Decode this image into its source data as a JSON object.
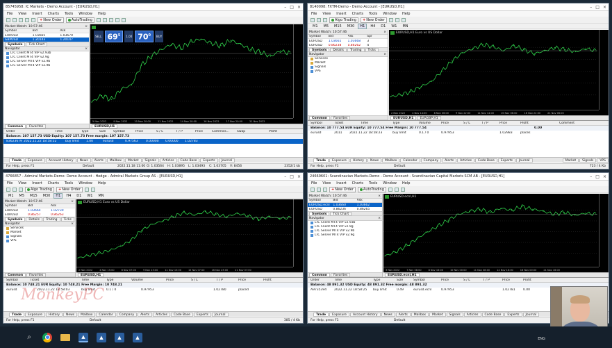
{
  "menus": [
    "File",
    "View",
    "Insert",
    "Charts",
    "Tools",
    "Window",
    "Help"
  ],
  "windows": {
    "tl": {
      "title": "85745958: IC Markets - Demo Account - [EURUSD,H1]",
      "toolbar": {
        "new_order": "New Order",
        "auto_trading": "AutoTrading"
      },
      "mw_header": "Market Watch: 10:57:46",
      "mw_cols": [
        "Symbol",
        "Bid",
        "Ask"
      ],
      "mw_rows": [
        [
          "EURUSD",
          "1.03665",
          "1.03670"
        ],
        [
          "GBPUSD",
          "1.20143",
          "1.20147"
        ]
      ],
      "mw_tabs": [
        "Symbols",
        "Tick Chart"
      ],
      "nav_header": "Navigator",
      "nav": [
        "LTC Client MT4 VIP v2.93b",
        "LTC Client MT4 VIP v2.9g",
        "LTC Server MT4 VIP v2.9b",
        "LTC Server MT4 VIP v2.9b"
      ],
      "nav_tabs": [
        "Common",
        "Favorites"
      ],
      "chart_label": "EURUSD,H1",
      "oc_sell": "SELL",
      "oc_buy": "BUY",
      "oc_lot": "1.00",
      "oc_bid": "69",
      "oc_bid_sup": "5",
      "oc_ask": "70",
      "oc_ask_sup": "0",
      "times": [
        "5 Nov 2022",
        "9 Nov 2022",
        "10 Nov 20:00",
        "11 Nov 2022",
        "14 Nov 20:00",
        "16 Nov 2022",
        "17 Nov 20:00",
        "21 Nov 2022"
      ],
      "chart_tab": "EURUSD,H1",
      "term_cols": [
        "Order",
        "Time",
        "Type",
        "Size",
        "Symbol",
        "Price",
        "S / L",
        "T / P",
        "Price",
        "Commiss...",
        "Swap",
        "Profit"
      ],
      "balance": "Balance: 107 157.73 USD  Equity: 107 157.73  Free margin: 107 157.73",
      "order_row": [
        "83623679",
        "2022.11.22 18:58:52",
        "buy limit",
        "1.00",
        "eurusd",
        "0.97563",
        "0.00000",
        "0.00000",
        "1.02783"
      ],
      "term_tabs": [
        "Trade",
        "Exposure",
        "Account History",
        "News",
        "Alerts",
        "Mailbox",
        "Market",
        "Signals",
        "Articles",
        "Code Base",
        "Experts",
        "Journal"
      ],
      "status": [
        "For Help, press F1",
        "Default",
        "2022.11.18 11:00",
        "O: 1.03564",
        "H: 1.03895",
        "L: 1.03493",
        "C: 1.03705",
        "V: 8456",
        "2352/1 kb"
      ]
    },
    "tr": {
      "title": "8140098: FXTM-Demo - Demo Account - [EURUSD,H1]",
      "toolbar": {
        "new_order": "New Order",
        "auto_trading": "Algo Trading"
      },
      "tfs": [
        "M1",
        "M5",
        "M15",
        "M30",
        "H1",
        "H4",
        "D1",
        "W1",
        "MN"
      ],
      "mw_header": "Market Watch: 10:57:46",
      "mw_cols": [
        "Symbol",
        "Bid",
        "Ask",
        "Spr"
      ],
      "mw_rows": [
        [
          "EURUSD",
          "1.03665",
          "1.03668",
          "3"
        ],
        [
          "EURUSD",
          "0.86238",
          "0.86262",
          "4"
        ]
      ],
      "mw_tabs": [
        "Symbols",
        "Details",
        "Trading",
        "Ticks"
      ],
      "nav_header": "Navigator",
      "nav": [
        "Services",
        "Market",
        "Signals",
        "VPS"
      ],
      "nav_tabs": [
        "Common",
        "Favorites"
      ],
      "chart_label": "EURUSD,H1  Euro vs US Dollar",
      "times": [
        "2 Nov 2022",
        "4 Nov 14:00",
        "8 Nov 06:00",
        "9 Nov 22:00",
        "11 Nov 14:00",
        "15 Nov 06:00",
        "16 Nov 22:00",
        "21 Nov 06:00"
      ],
      "chart_tabs": [
        "EURUSD,H1",
        "EURGBP,H1"
      ],
      "term_cols": [
        "Symbol",
        "Ticket",
        "Time",
        "Type",
        "Volume",
        "Price",
        "S / L",
        "T / P",
        "Price",
        "Profit",
        "Comment"
      ],
      "balance": "Balance: 10 777.54 EUR  Equity: 10 777.54  Free Margin: 10 777.54",
      "balance_profit": "0.00",
      "order_row": [
        "eurusd",
        "2011",
        "2022.11.22 18:58:23",
        "buy limit",
        "0.1 / 0",
        "0.97953",
        "",
        "",
        "1.02983",
        "places"
      ],
      "term_tabs": [
        "Trade",
        "Exposure",
        "History",
        "News",
        "Mailbox",
        "Calendar",
        "Company",
        "Alerts",
        "Articles",
        "Code Base",
        "Experts",
        "Journal"
      ],
      "term_right": [
        "Market",
        "Signals",
        "VPS"
      ],
      "status": [
        "For Help, press F1",
        "Default",
        "723 / 4 Kb"
      ]
    },
    "bl": {
      "title": "4766857 - Admiral Markets-Demo: Demo Account - Hedge - Admiral Markets Group AS - [EURUSD,H1]",
      "toolbar": {
        "new_order": "New Order",
        "auto_trading": "Algo Trading"
      },
      "tfs": [
        "M1",
        "M5",
        "M15",
        "M30",
        "H1",
        "H4",
        "D1",
        "W1",
        "MN"
      ],
      "mw_header": "Market Watch: 10:57:46",
      "mw_cols": [
        "Symbol",
        "Bid",
        "Ask"
      ],
      "mw_rows": [
        [
          "EURUSD",
          "1.03664",
          "1.02730"
        ],
        [
          "EURUSD",
          "0.86257",
          "0.86263"
        ]
      ],
      "mw_tabs": [
        "Symbols",
        "Details",
        "Trading",
        "Ticks"
      ],
      "nav_header": "Navigator",
      "nav": [
        "Services",
        "Market",
        "Signals",
        "VPS"
      ],
      "nav_tabs": [
        "Common",
        "Favorites"
      ],
      "chart_label": "EURUSD,H1  Euro vs US Dollar",
      "times": [
        "2 Nov 2022",
        "4 Nov 15:00",
        "8 Nov 07:00",
        "9 Nov 23:00",
        "11 Nov 15:00",
        "15 Nov 07:00",
        "16 Nov 23:00",
        "21 Nov 07:00"
      ],
      "chart_tab": "EURUSD,H1",
      "term_cols": [
        "Symbol",
        "Ticket",
        "Time",
        "Type",
        "Volume",
        "Price",
        "S / L",
        "T / P",
        "Price",
        "Profit"
      ],
      "balance": "Balance: 10 748.21 EUR  Equity: 10 748.21  Free Margin: 10 748.21",
      "order_row": [
        "eurusd",
        "",
        "2022.11.22 18:58:03",
        "buy limit",
        "0.1 / 0",
        "0.97953",
        "",
        "",
        "1.02780",
        "placed"
      ],
      "term_tabs": [
        "Trade",
        "Exposure",
        "History",
        "News",
        "Mailbox",
        "Calendar",
        "Company",
        "Alerts",
        "Articles",
        "Code Base",
        "Experts",
        "Journal"
      ],
      "status": [
        "For Help, press F1",
        "Default",
        "385 / 4 Kb"
      ]
    },
    "br": {
      "title": "24669601: Scandinavian Markets-Demo - Demo Account - Scandinavian Capital Markets SCM AB - [EURUSD,H1]",
      "toolbar": {
        "new_order": "New Order",
        "auto_trading": "AutoTrading"
      },
      "mw_header": "Market Watch: 10:57:46",
      "mw_cols": [
        "Symbol",
        "Bid",
        "Ask"
      ],
      "mw_rows": [
        [
          "EURUSD.ecnl",
          "1.03660",
          "1.03662"
        ],
        [
          "EURUSD",
          "0.86236",
          "0.86265"
        ]
      ],
      "mw_tabs": [
        "Symbols",
        "Tick Chart"
      ],
      "nav_header": "Navigator",
      "nav": [
        "LTC Client MT4 VIP v2.93b",
        "LTC Client MT4 VIP v2.9g",
        "LTC Server MT4 VIP v2.9b",
        "LTC Server MT4 VIP v2.9g"
      ],
      "nav_tabs": [
        "Common",
        "Favorites"
      ],
      "chart_label": "EURUSD.ecnl,H1",
      "times": [
        "3 Nov 2022",
        "7 Nov 08:00",
        "8 Nov 16:00",
        "10 Nov 00:00",
        "11 Nov 08:00",
        "14 Nov 16:00",
        "16 Nov 00:00",
        "21 Nov 16:00"
      ],
      "chart_tab": "EURUSD.ecnl,H1",
      "term_cols": [
        "Order",
        "Time",
        "Type",
        "Size",
        "Symbol",
        "Price",
        "S / L",
        "T / P",
        "Price",
        "Profit"
      ],
      "balance": "Balance: 48 891.32 USD  Equity: 48 891.32  Free margin: 48 891.32",
      "order_row": [
        "A9735394",
        "2022.11.22 18:58:25",
        "buy limit",
        "0.49",
        "eurusd.ecnl",
        "0.97953",
        "",
        "",
        "1.02781",
        "0.00"
      ],
      "term_tabs": [
        "Trade",
        "Exposure",
        "Account History",
        "News",
        "Alerts",
        "Mailbox",
        "Market",
        "Signals",
        "Articles",
        "Code Base",
        "Experts",
        "Journal"
      ],
      "status": [
        "For Help, press F1",
        "Default",
        "3862 / 1 kb"
      ]
    }
  },
  "watermark": "MonkeyPC",
  "tray": "ENG",
  "chart_data": [
    {
      "type": "line",
      "window": "tl",
      "x": [
        0,
        10,
        20,
        30,
        40,
        50,
        60,
        70,
        80,
        90,
        100,
        110,
        120,
        130,
        140,
        150,
        160,
        170,
        180,
        190,
        200
      ],
      "y": [
        0.99,
        0.995,
        0.992,
        1.0,
        1.003,
        1.018,
        1.025,
        1.03,
        1.034,
        1.031,
        1.036,
        1.038,
        1.035,
        1.033,
        1.037,
        1.034,
        1.03,
        1.028,
        1.025,
        1.029,
        1.027
      ],
      "ylim": [
        0.98,
        1.045
      ]
    },
    {
      "type": "line",
      "window": "tr",
      "x": [
        0,
        10,
        20,
        30,
        40,
        50,
        60,
        70,
        80,
        90,
        100,
        110,
        120,
        130,
        140,
        150,
        160,
        170,
        180,
        190,
        200
      ],
      "y": [
        0.985,
        0.987,
        0.99,
        0.995,
        1.0,
        1.01,
        1.02,
        1.028,
        1.032,
        1.036,
        1.034,
        1.03,
        1.035,
        1.031,
        1.027,
        1.03,
        1.033,
        1.031,
        1.029,
        1.032,
        1.03
      ],
      "ylim": [
        0.975,
        1.045
      ]
    },
    {
      "type": "line",
      "window": "bl",
      "x": [
        0,
        10,
        20,
        30,
        40,
        50,
        60,
        70,
        80,
        90,
        100,
        110,
        120,
        130,
        140,
        150,
        160,
        170,
        180,
        190,
        200
      ],
      "y": [
        0.982,
        0.985,
        0.988,
        0.991,
        0.996,
        1.003,
        1.015,
        1.022,
        1.026,
        1.031,
        1.036,
        1.033,
        1.037,
        1.034,
        1.031,
        1.035,
        1.032,
        1.028,
        1.031,
        1.029,
        1.03
      ],
      "ylim": [
        0.975,
        1.045
      ]
    },
    {
      "type": "line",
      "window": "br",
      "x": [
        0,
        10,
        20,
        30,
        40,
        50,
        60,
        70,
        80,
        90,
        100,
        110,
        120,
        130,
        140,
        150,
        160,
        170,
        180,
        190,
        200
      ],
      "y": [
        0.988,
        0.992,
        0.998,
        1.005,
        1.012,
        1.018,
        1.024,
        1.03,
        1.033,
        1.035,
        1.032,
        1.036,
        1.034,
        1.038,
        1.035,
        1.033,
        1.03,
        1.032,
        1.029,
        1.031,
        1.03
      ],
      "ylim": [
        0.98,
        1.045
      ]
    }
  ]
}
